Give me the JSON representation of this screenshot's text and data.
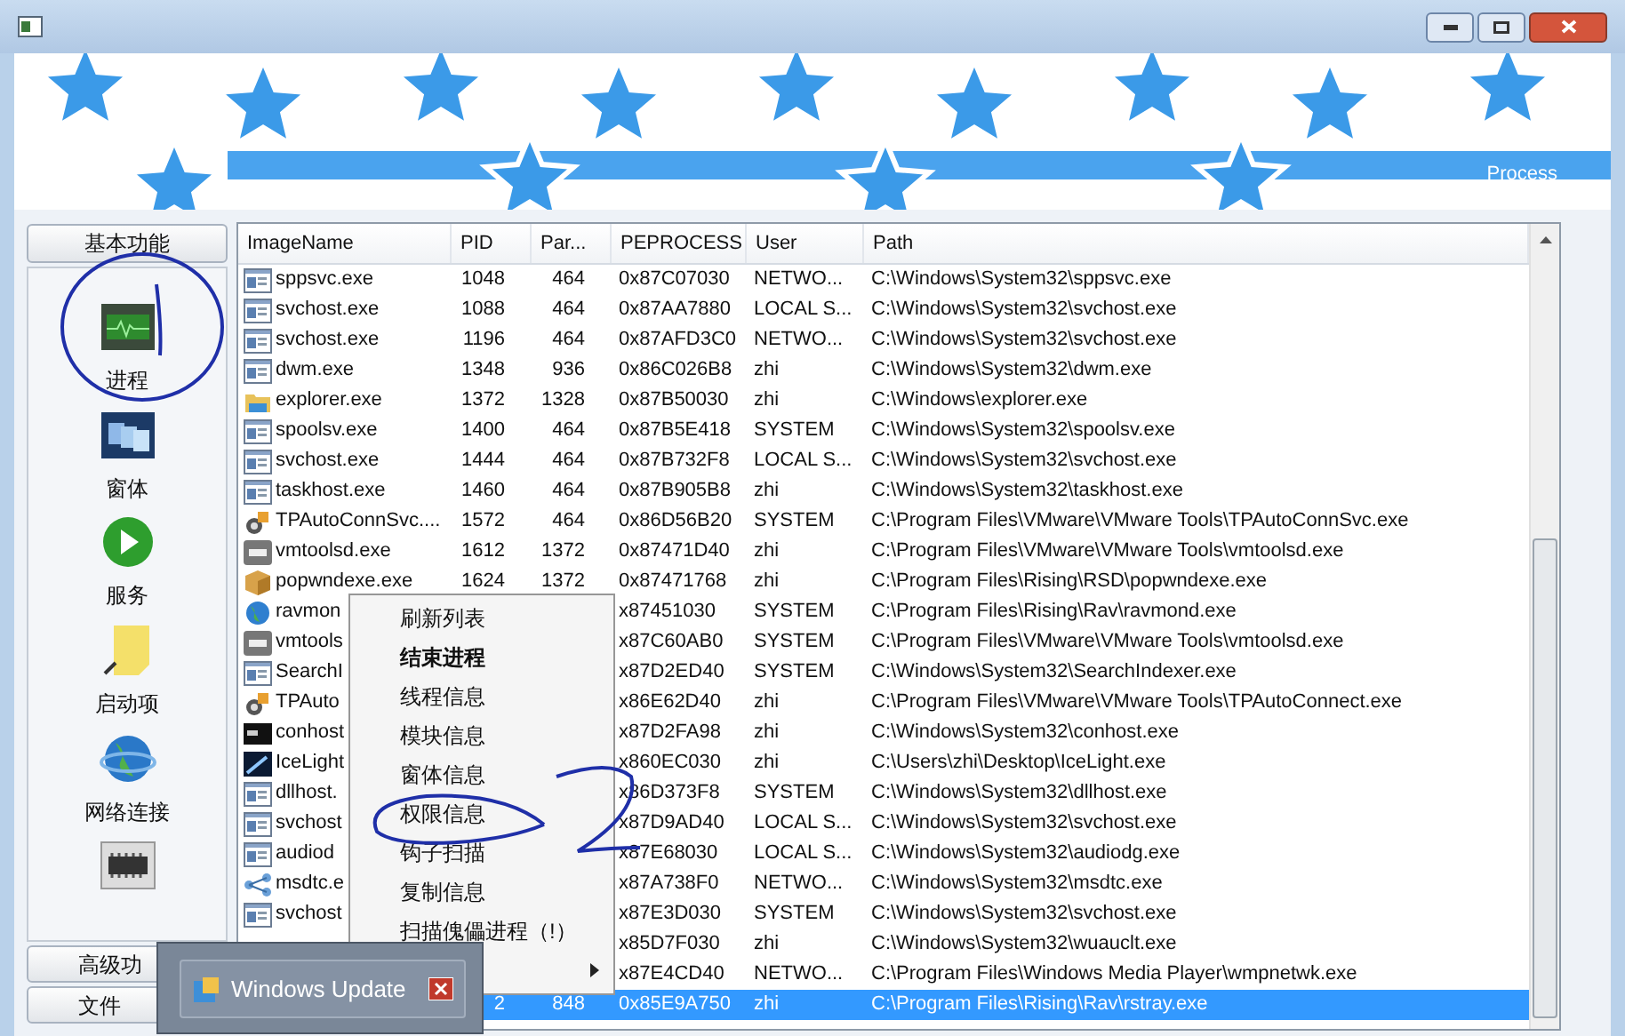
{
  "banner": {
    "caption": "Process"
  },
  "sidebar": {
    "top_button": "基本功能",
    "items": [
      {
        "label": "进程",
        "kind": "monitor"
      },
      {
        "label": "窗体",
        "kind": "windows"
      },
      {
        "label": "服务",
        "kind": "play"
      },
      {
        "label": "启动项",
        "kind": "note"
      },
      {
        "label": "网络连接",
        "kind": "globe"
      },
      {
        "kind": "chip"
      }
    ],
    "bottom_buttons": [
      "高级功",
      "文件"
    ]
  },
  "table": {
    "columns": [
      "ImageName",
      "PID",
      "Par...",
      "PEPROCESS",
      "User",
      "Path"
    ],
    "rows": [
      {
        "kind": "app",
        "name": "sppsvc.exe",
        "pid": "1048",
        "parent": "464",
        "peprocess": "0x87C07030",
        "user": "NETWO...",
        "path": "C:\\Windows\\System32\\sppsvc.exe",
        "selected": false
      },
      {
        "kind": "app",
        "name": "svchost.exe",
        "pid": "1088",
        "parent": "464",
        "peprocess": "0x87AA7880",
        "user": "LOCAL S...",
        "path": "C:\\Windows\\System32\\svchost.exe",
        "selected": false
      },
      {
        "kind": "app",
        "name": "svchost.exe",
        "pid": "1196",
        "parent": "464",
        "peprocess": "0x87AFD3C0",
        "user": "NETWO...",
        "path": "C:\\Windows\\System32\\svchost.exe",
        "selected": false
      },
      {
        "kind": "app",
        "name": "dwm.exe",
        "pid": "1348",
        "parent": "936",
        "peprocess": "0x86C026B8",
        "user": "zhi",
        "path": "C:\\Windows\\System32\\dwm.exe",
        "selected": false
      },
      {
        "kind": "folder",
        "name": "explorer.exe",
        "pid": "1372",
        "parent": "1328",
        "peprocess": "0x87B50030",
        "user": "zhi",
        "path": "C:\\Windows\\explorer.exe",
        "selected": false
      },
      {
        "kind": "app",
        "name": "spoolsv.exe",
        "pid": "1400",
        "parent": "464",
        "peprocess": "0x87B5E418",
        "user": "SYSTEM",
        "path": "C:\\Windows\\System32\\spoolsv.exe",
        "selected": false
      },
      {
        "kind": "app",
        "name": "svchost.exe",
        "pid": "1444",
        "parent": "464",
        "peprocess": "0x87B732F8",
        "user": "LOCAL S...",
        "path": "C:\\Windows\\System32\\svchost.exe",
        "selected": false
      },
      {
        "kind": "app",
        "name": "taskhost.exe",
        "pid": "1460",
        "parent": "464",
        "peprocess": "0x87B905B8",
        "user": "zhi",
        "path": "C:\\Windows\\System32\\taskhost.exe",
        "selected": false
      },
      {
        "kind": "network",
        "name": "TPAutoConnSvc....",
        "pid": "1572",
        "parent": "464",
        "peprocess": "0x86D56B20",
        "user": "SYSTEM",
        "path": "C:\\Program Files\\VMware\\VMware Tools\\TPAutoConnSvc.exe",
        "selected": false
      },
      {
        "kind": "vm",
        "name": "vmtoolsd.exe",
        "pid": "1612",
        "parent": "1372",
        "peprocess": "0x87471D40",
        "user": "zhi",
        "path": "C:\\Program Files\\VMware\\VMware Tools\\vmtoolsd.exe",
        "selected": false
      },
      {
        "kind": "box",
        "name": "popwndexe.exe",
        "pid": "1624",
        "parent": "1372",
        "peprocess": "0x87471768",
        "user": "zhi",
        "path": "C:\\Program Files\\Rising\\RSD\\popwndexe.exe",
        "selected": false
      },
      {
        "kind": "globe",
        "name": "ravmon",
        "peprocess": "x87451030",
        "user": "SYSTEM",
        "path": "C:\\Program Files\\Rising\\Rav\\ravmond.exe",
        "selected": false
      },
      {
        "kind": "vm",
        "name": "vmtools",
        "peprocess": "x87C60AB0",
        "user": "SYSTEM",
        "path": "C:\\Program Files\\VMware\\VMware Tools\\vmtoolsd.exe",
        "selected": false
      },
      {
        "kind": "app",
        "name": "SearchI",
        "peprocess": "x87D2ED40",
        "user": "SYSTEM",
        "path": "C:\\Windows\\System32\\SearchIndexer.exe",
        "selected": false
      },
      {
        "kind": "network",
        "name": "TPAuto",
        "peprocess": "x86E62D40",
        "user": "zhi",
        "path": "C:\\Program Files\\VMware\\VMware Tools\\TPAutoConnect.exe",
        "selected": false
      },
      {
        "kind": "console",
        "name": "conhost",
        "peprocess": "x87D2FA98",
        "user": "zhi",
        "path": "C:\\Windows\\System32\\conhost.exe",
        "selected": false
      },
      {
        "kind": "dark",
        "name": "IceLight",
        "peprocess": "x860EC030",
        "user": "zhi",
        "path": "C:\\Users\\zhi\\Desktop\\IceLight.exe",
        "selected": false
      },
      {
        "kind": "app",
        "name": "dllhost.",
        "peprocess": "x86D373F8",
        "user": "SYSTEM",
        "path": "C:\\Windows\\System32\\dllhost.exe",
        "selected": false
      },
      {
        "kind": "app",
        "name": "svchost",
        "peprocess": "x87D9AD40",
        "user": "LOCAL S...",
        "path": "C:\\Windows\\System32\\svchost.exe",
        "selected": false
      },
      {
        "kind": "app",
        "name": "audiod",
        "peprocess": "x87E68030",
        "user": "LOCAL S...",
        "path": "C:\\Windows\\System32\\audiodg.exe",
        "selected": false
      },
      {
        "kind": "share",
        "name": "msdtc.e",
        "peprocess": "x87A738F0",
        "user": "NETWO...",
        "path": "C:\\Windows\\System32\\msdtc.exe",
        "selected": false
      },
      {
        "kind": "app",
        "name": "svchost",
        "peprocess": "x87E3D030",
        "user": "SYSTEM",
        "path": "C:\\Windows\\System32\\svchost.exe",
        "selected": false
      },
      {
        "peprocess": "x85D7F030",
        "user": "zhi",
        "path": "C:\\Windows\\System32\\wuauclt.exe",
        "selected": false
      },
      {
        "peprocess": "x87E4CD40",
        "user": "NETWO...",
        "path": "C:\\Program Files\\Windows Media Player\\wmpnetwk.exe",
        "selected": false
      },
      {
        "pid": "2",
        "parent": "848",
        "peprocess": "0x85E9A750",
        "user": "zhi",
        "path": "C:\\Program Files\\Rising\\Rav\\rstray.exe",
        "selected": true
      }
    ]
  },
  "context_menu": {
    "items": [
      {
        "kind": "normal",
        "label": "刷新列表"
      },
      {
        "kind": "bold",
        "label": "结束进程"
      },
      {
        "kind": "normal",
        "label": "线程信息"
      },
      {
        "kind": "normal",
        "label": "模块信息"
      },
      {
        "kind": "normal",
        "label": "窗体信息"
      },
      {
        "kind": "normal",
        "label": "权限信息"
      },
      {
        "kind": "normal",
        "label": "钩子扫描"
      },
      {
        "kind": "normal",
        "label": "复制信息"
      },
      {
        "kind": "normal",
        "label": "扫描傀儡进程（!）"
      },
      {
        "kind": "submenu"
      }
    ]
  },
  "notification": {
    "title": "Windows Update"
  }
}
